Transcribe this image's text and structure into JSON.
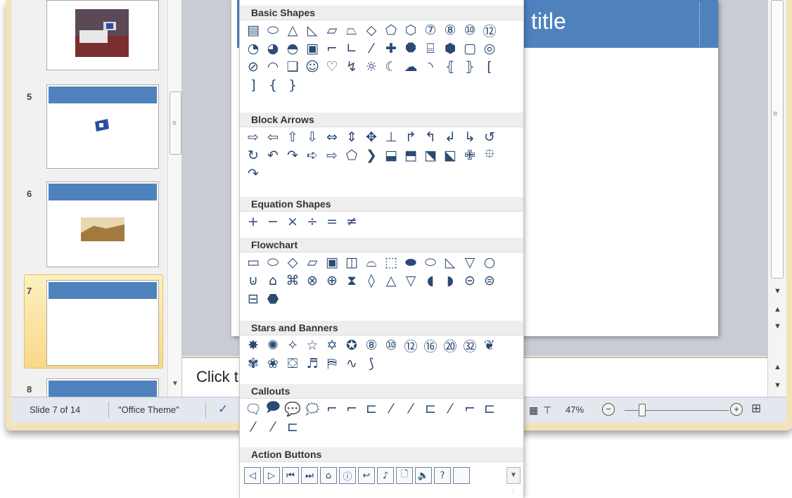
{
  "thumbnails": {
    "slides": [
      {
        "number": "5"
      },
      {
        "number": "6"
      },
      {
        "number": "7"
      },
      {
        "number": "8"
      }
    ]
  },
  "slide": {
    "title_fragment": "title"
  },
  "notes": {
    "text": "Click t"
  },
  "status": {
    "slide_indicator": "Slide 7 of 14",
    "theme": "\"Office Theme\"",
    "zoom": "47%",
    "zoom_minus": "−",
    "zoom_plus": "+"
  },
  "gallery": {
    "categories": [
      {
        "name": "Basic Shapes",
        "shapes": [
          "▤",
          "⬭",
          "△",
          "◺",
          "▱",
          "⏢",
          "◇",
          "⬠",
          "⬡",
          "⑦",
          "⑧",
          "⑩",
          "⑫",
          "◔",
          "◕",
          "◓",
          "▣",
          "⌐",
          "∟",
          "⁄",
          "✚",
          "⯃",
          "⌸",
          "⬢",
          "▢",
          "◎",
          "⊘",
          "◠",
          "❑",
          "☺",
          "♡",
          "↯",
          "☼",
          "☾",
          "☁",
          "◝",
          "⦃",
          "⦄",
          "[",
          "]",
          "{",
          "}"
        ]
      },
      {
        "name": "Block Arrows",
        "shapes": [
          "⇨",
          "⇦",
          "⇧",
          "⇩",
          "⇔",
          "⇕",
          "✥",
          "⊥",
          "↱",
          "↰",
          "↲",
          "↳",
          "↺",
          "↻",
          "↶",
          "↷",
          "➪",
          "⇨",
          "⬠",
          "❯",
          "⬓",
          "⬒",
          "⬔",
          "⬕",
          "✙",
          "⯐",
          "↷"
        ]
      },
      {
        "name": "Equation Shapes",
        "shapes": [
          "+",
          "−",
          "×",
          "÷",
          "=",
          "≠"
        ]
      },
      {
        "name": "Flowchart",
        "shapes": [
          "▭",
          "⬭",
          "◇",
          "▱",
          "▣",
          "◫",
          "⌓",
          "⬚",
          "⬬",
          "⬭",
          "◺",
          "▽",
          "○",
          "⊍",
          "⌂",
          "⌘",
          "⊗",
          "⊕",
          "⧗",
          "◊",
          "△",
          "▽",
          "◖",
          "◗",
          "⊝",
          "⊜",
          "⊟",
          "⬣"
        ]
      },
      {
        "name": "Stars and Banners",
        "shapes": [
          "✸",
          "✺",
          "✧",
          "☆",
          "✡",
          "✪",
          "⑧",
          "⑩",
          "⑫",
          "⑯",
          "⑳",
          "㉜",
          "❦",
          "✾",
          "❀",
          "⛋",
          "♬",
          "⛿",
          "∿",
          "⟆"
        ]
      },
      {
        "name": "Callouts",
        "shapes": [
          "🗨",
          "🗩",
          "💬",
          "🗯",
          "⌐",
          "⌐",
          "⊏",
          "⁄",
          "⁄",
          "⊏",
          "⁄",
          "⌐",
          "⊏",
          "⁄",
          "⁄",
          "⊏"
        ]
      },
      {
        "name": "Action Buttons",
        "shapes": [
          "◁",
          "▷",
          "⏮",
          "⏭",
          "⌂",
          "ⓘ",
          "↩",
          "♪",
          "🗋",
          "🔈",
          "?",
          ""
        ]
      }
    ]
  }
}
